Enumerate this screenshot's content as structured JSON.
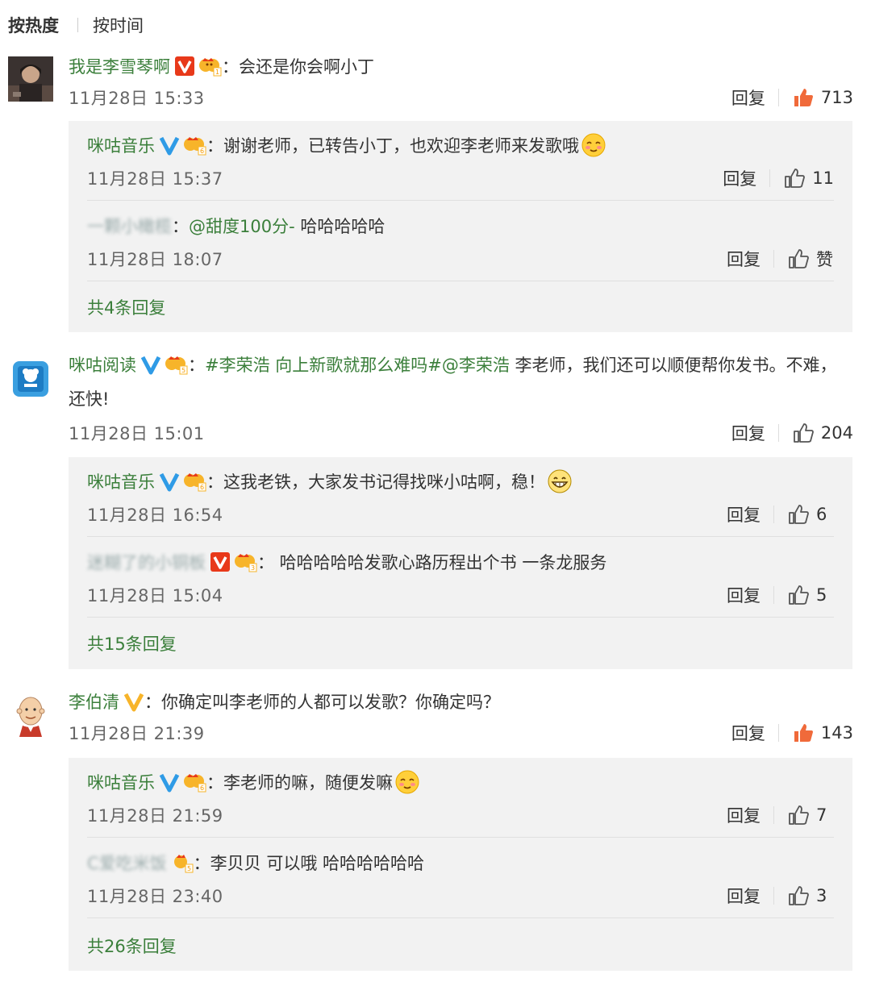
{
  "sort": {
    "hot": "按热度",
    "time": "按时间"
  },
  "reply_label": "回复",
  "colors": {
    "name_green": "#3b7f3b",
    "like_orange": "#f06a3a",
    "verified_blue": "#2f9be6",
    "verified_red": "#e8391a",
    "verified_gold": "#f7b42a"
  },
  "comments": [
    {
      "user": "我是李雪琴啊",
      "badge": "red-v-icon",
      "text": "：会还是你会啊小丁",
      "time": "11月28日 15:33",
      "likes": "713",
      "liked": true,
      "replies": [
        {
          "user": "咪咕音乐",
          "badge": "blue-v-icon",
          "text": "：谢谢老师，已转告小丁，也欢迎李老师来发歌哦",
          "emoji": "shy-smile-emoji",
          "time": "11月28日 15:37",
          "likes": "11"
        },
        {
          "user": "一颗小橄榄",
          "text_prefix": "：",
          "mention": "@甜度100分-",
          "text": " 哈哈哈哈哈",
          "time": "11月28日 18:07",
          "likes": "赞"
        }
      ],
      "more": "共4条回复"
    },
    {
      "user": "咪咕阅读",
      "badge": "blue-v-icon",
      "topic": "#李荣浩 向上新歌就那么难吗#@李荣浩",
      "text": " 李老师，我们还可以顺便帮你发书。不难，还快!",
      "time": "11月28日 15:01",
      "likes": "204",
      "liked": false,
      "replies": [
        {
          "user": "咪咕音乐",
          "badge": "blue-v-icon",
          "text": "：这我老铁，大家发书记得找咪小咕啊，稳！",
          "emoji": "grin-emoji",
          "time": "11月28日 16:54",
          "likes": "6"
        },
        {
          "user": "迷糊了的小铜板",
          "badge": "red-v-icon",
          "text": "： 哈哈哈哈哈发歌心路历程出个书 一条龙服务",
          "time": "11月28日 15:04",
          "likes": "5"
        }
      ],
      "more": "共15条回复"
    },
    {
      "user": "李伯清",
      "badge": "gold-v-icon",
      "text": "：你确定叫李老师的人都可以发歌？你确定吗？",
      "time": "11月28日 21:39",
      "likes": "143",
      "liked": true,
      "replies": [
        {
          "user": "咪咕音乐",
          "badge": "blue-v-icon",
          "text": "：李老师的嘛，随便发嘛",
          "emoji": "shy-smile-emoji",
          "time": "11月28日 21:59",
          "likes": "7"
        },
        {
          "user": "C爱吃米饭",
          "text": "：李贝贝 可以哦 哈哈哈哈哈哈",
          "time": "11月28日 23:40",
          "likes": "3"
        }
      ],
      "more": "共26条回复"
    }
  ]
}
